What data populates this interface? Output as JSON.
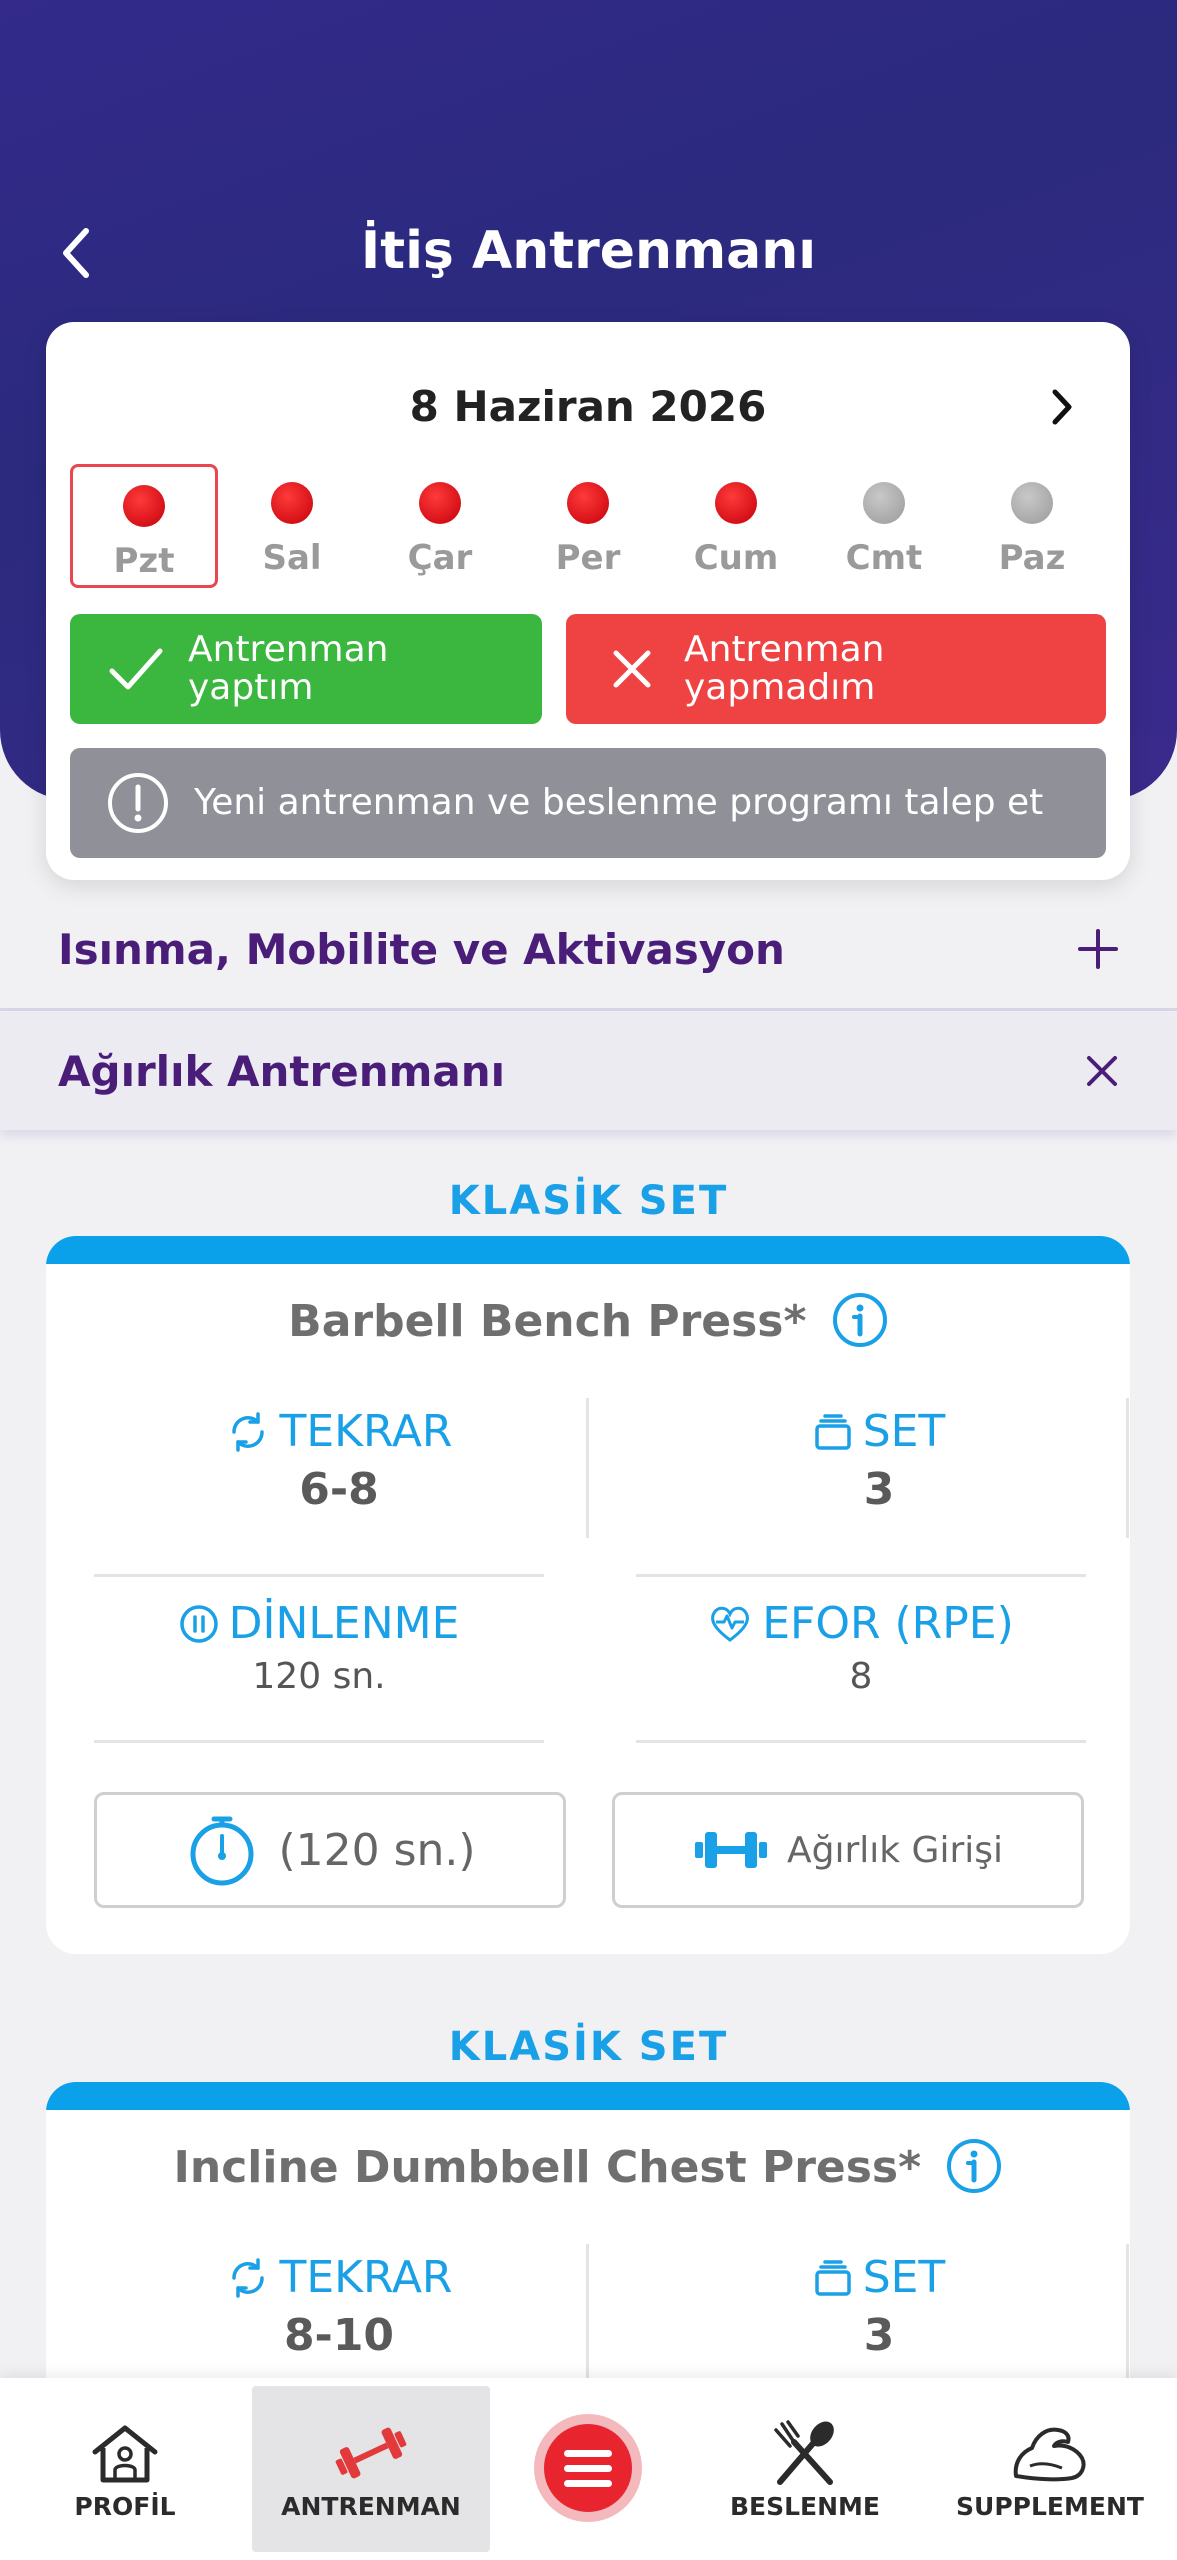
{
  "header": {
    "title": "İtiş Antrenmanı"
  },
  "calendar": {
    "date": "8 Haziran 2026",
    "days": [
      {
        "label": "Pzt",
        "status": "red",
        "selected": true
      },
      {
        "label": "Sal",
        "status": "red",
        "selected": false
      },
      {
        "label": "Çar",
        "status": "red",
        "selected": false
      },
      {
        "label": "Per",
        "status": "red",
        "selected": false
      },
      {
        "label": "Cum",
        "status": "red",
        "selected": false
      },
      {
        "label": "Cmt",
        "status": "gray",
        "selected": false
      },
      {
        "label": "Paz",
        "status": "gray",
        "selected": false
      }
    ],
    "done_button": "Antrenman yaptım",
    "not_done_button": "Antrenman yapmadım",
    "request_button": "Yeni antrenman ve beslenme programı talep et"
  },
  "sections": {
    "warmup": "Isınma, Mobilite ve Aktivasyon",
    "weights": "Ağırlık Antrenmanı"
  },
  "exercises": [
    {
      "set_type": "KLASİK SET",
      "name": "Barbell Bench Press*",
      "reps_label": "TEKRAR",
      "reps": "6-8",
      "sets_label": "SET",
      "sets": "3",
      "rest_label": "DİNLENME",
      "rest": "120 sn.",
      "effort_label": "EFOR (RPE)",
      "effort": "8",
      "timer_button": "(120 sn.)",
      "weight_button": "Ağırlık Girişi"
    },
    {
      "set_type": "KLASİK SET",
      "name": "Incline Dumbbell Chest Press*",
      "reps_label": "TEKRAR",
      "reps": "8-10",
      "sets_label": "SET",
      "sets": "3"
    }
  ],
  "bottom_nav": {
    "items": [
      {
        "label": "PROFİL",
        "icon": "home-icon"
      },
      {
        "label": "ANTRENMAN",
        "icon": "dumbbell-icon"
      },
      {
        "label": "",
        "icon": "menu-icon"
      },
      {
        "label": "BESLENME",
        "icon": "fork-knife-icon"
      },
      {
        "label": "SUPPLEMENT",
        "icon": "muscle-arm-icon"
      }
    ]
  },
  "colors": {
    "hero": "#2f2a85",
    "accent_blue": "#0aa0ea",
    "success": "#3bb63f",
    "danger": "#ef4343",
    "section_text": "#4a1e78"
  }
}
